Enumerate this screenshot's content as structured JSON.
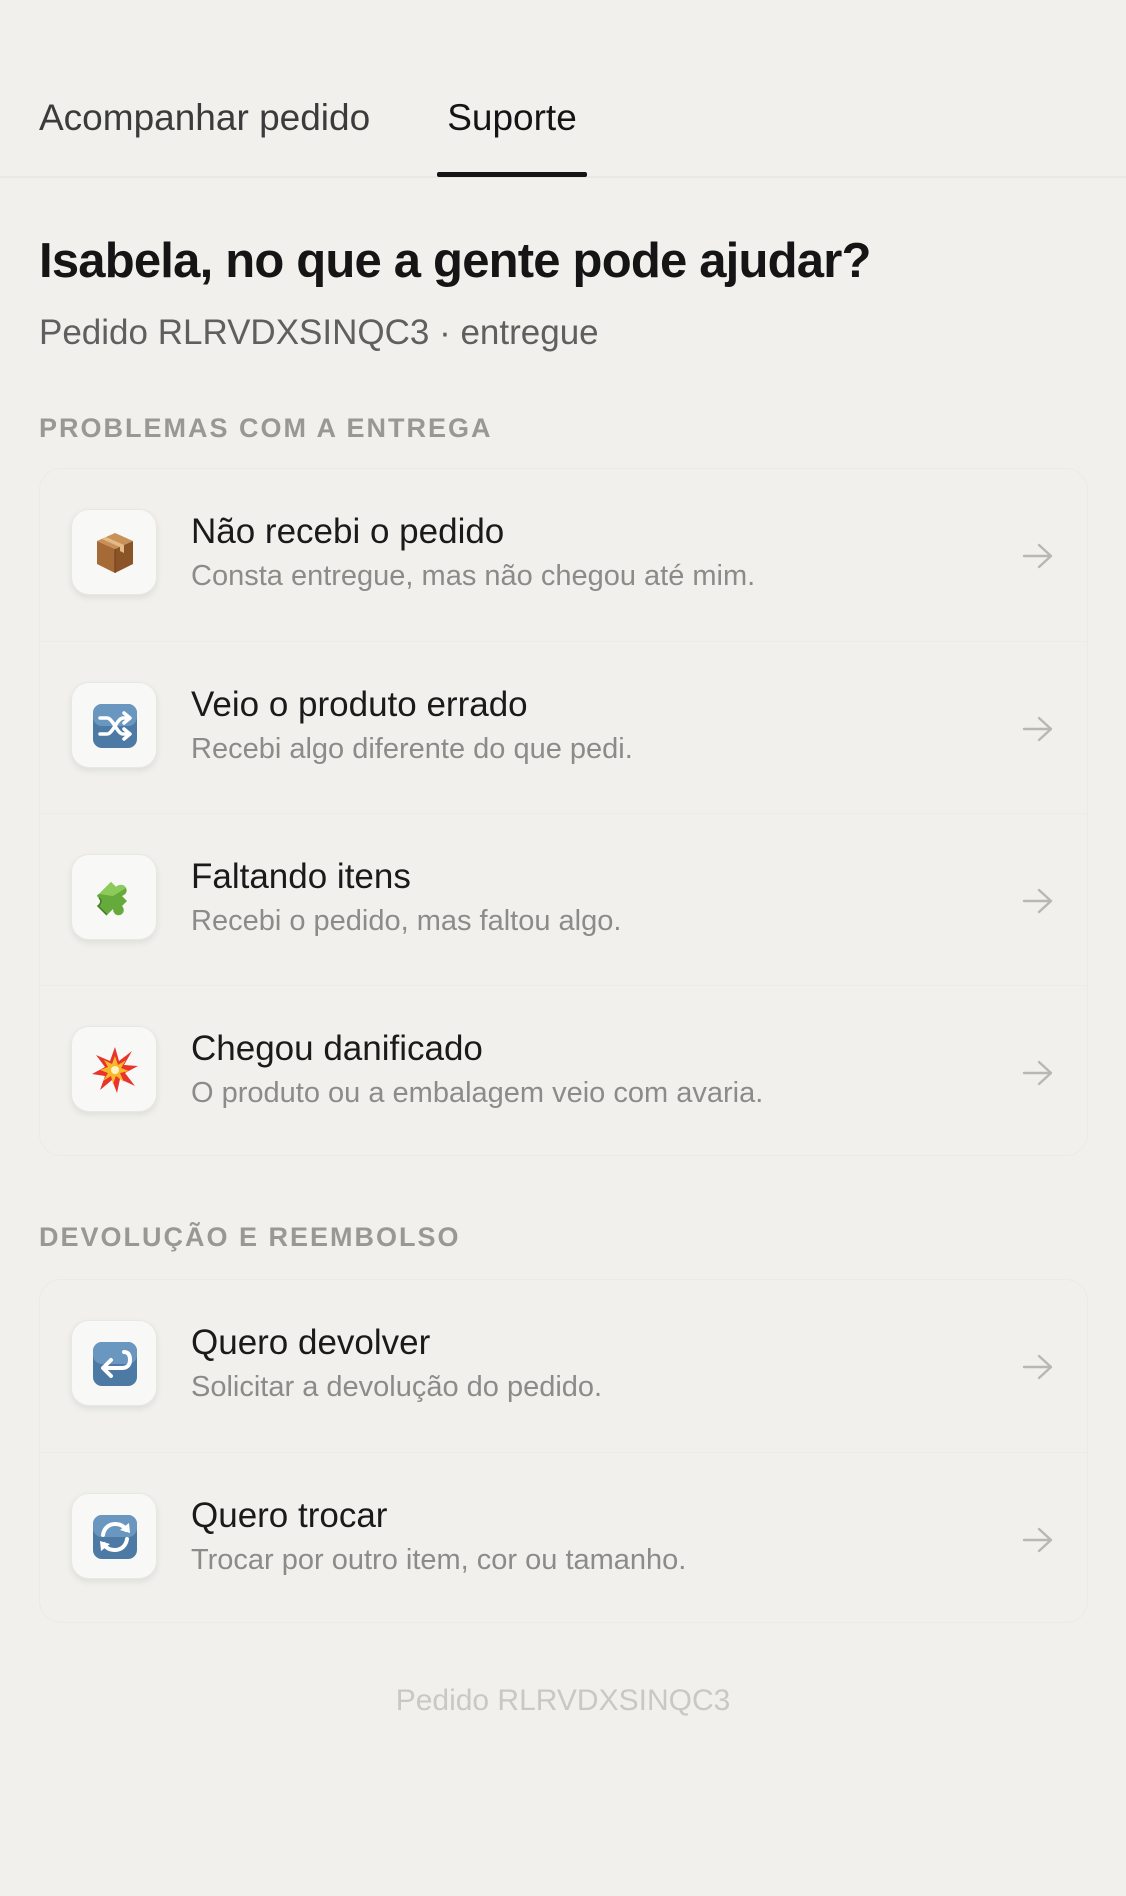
{
  "tabs": {
    "track_order": "Acompanhar pedido",
    "support": "Suporte",
    "active": "support"
  },
  "header": {
    "title": "Isabela, no que a gente pode ajudar?",
    "subtitle": "Pedido RLRVDXSINQC3 · entregue"
  },
  "sections": [
    {
      "label": "PROBLEMAS COM A ENTREGA",
      "items": [
        {
          "icon": "package-icon",
          "title": "Não recebi o pedido",
          "description": "Consta entregue, mas não chegou até mim."
        },
        {
          "icon": "shuffle-icon",
          "title": "Veio o produto errado",
          "description": "Recebi algo diferente do que pedi."
        },
        {
          "icon": "puzzle-piece-icon",
          "title": "Faltando itens",
          "description": "Recebi o pedido, mas faltou algo."
        },
        {
          "icon": "collision-icon",
          "title": "Chegou danificado",
          "description": "O produto ou a embalagem veio com avaria."
        }
      ]
    },
    {
      "label": "DEVOLUÇÃO E REEMBOLSO",
      "items": [
        {
          "icon": "return-arrow-icon",
          "title": "Quero devolver",
          "description": "Solicitar a devolução do pedido."
        },
        {
          "icon": "cycle-arrows-icon",
          "title": "Quero trocar",
          "description": "Trocar por outro item, cor ou tamanho."
        }
      ]
    }
  ],
  "footer": {
    "text": "Pedido RLRVDXSINQC3"
  },
  "colors": {
    "background": "#f1f0ec",
    "active_tab_underline": "#151515",
    "section_label": "#999893",
    "description": "#8b8b89",
    "footer": "#c9c8c4"
  }
}
